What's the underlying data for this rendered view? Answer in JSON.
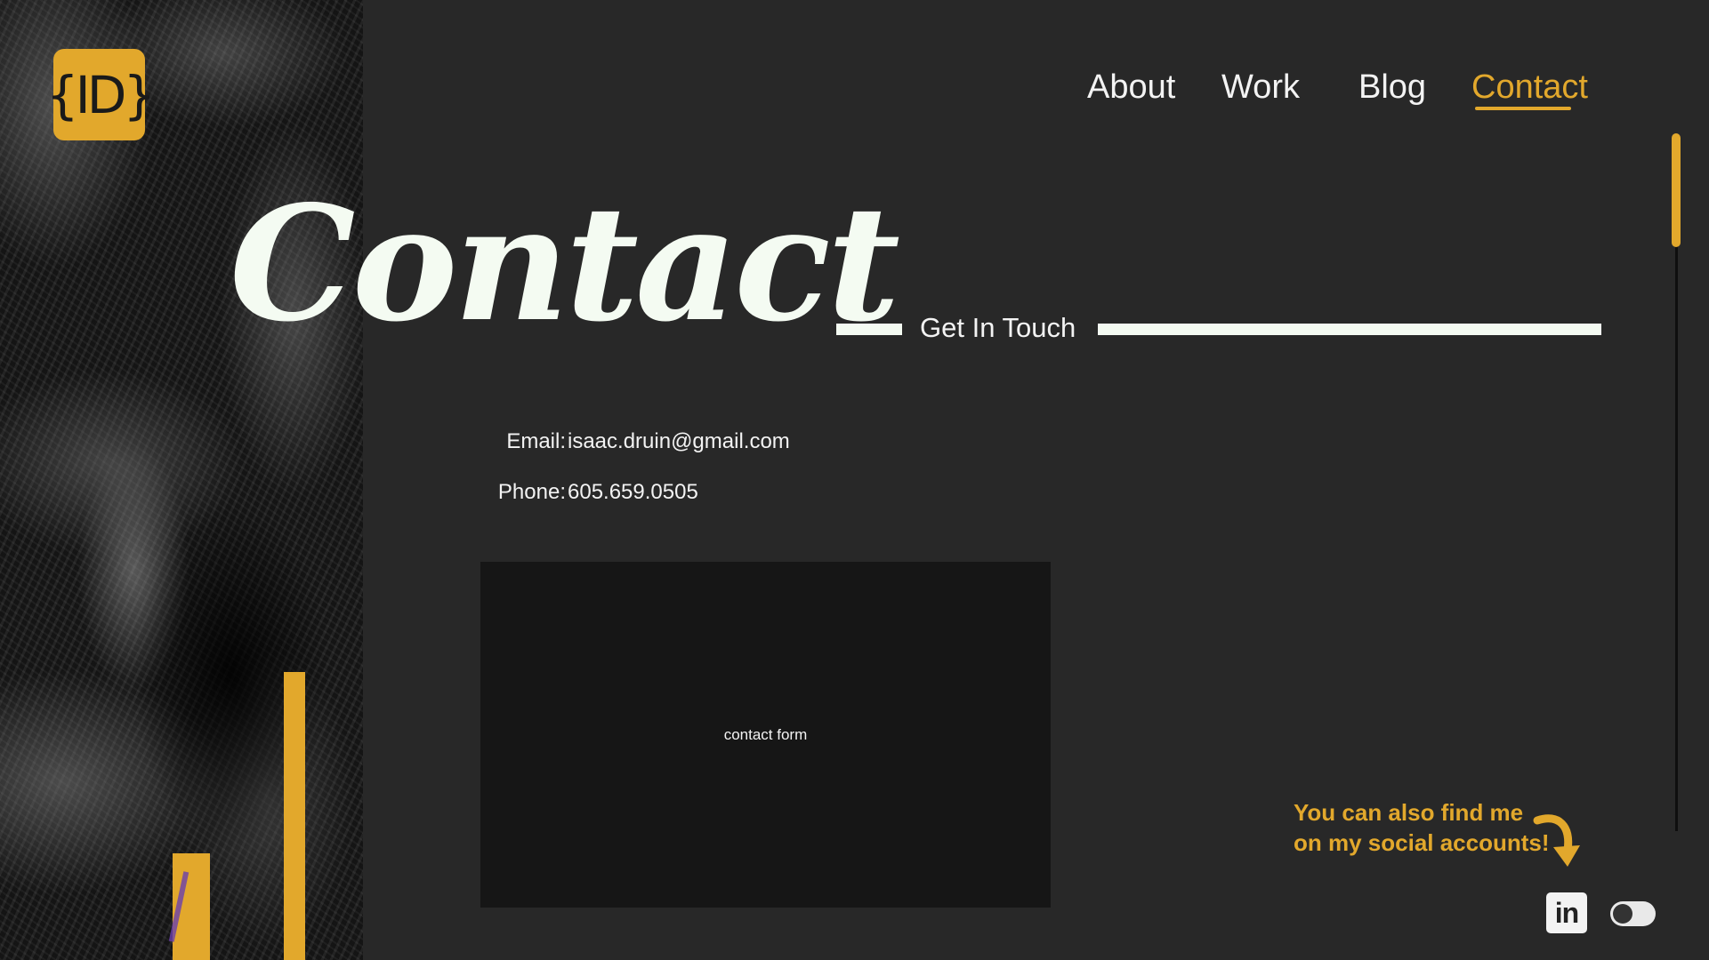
{
  "logo": {
    "text": "{ID}"
  },
  "nav": {
    "items": [
      {
        "label": "About"
      },
      {
        "label": "Work"
      },
      {
        "label": "Blog"
      },
      {
        "label": "Contact",
        "active": true
      }
    ]
  },
  "hero": {
    "title": "Contact",
    "subtitle": "Get In Touch"
  },
  "contact": {
    "email_label": "Email:",
    "email_value": "isaac.druin@gmail.com",
    "phone_label": "Phone:",
    "phone_value": "605.659.0505"
  },
  "form": {
    "placeholder": "contact form"
  },
  "social": {
    "note_line1": "You can also find me",
    "note_line2": "on my social accounts!",
    "linkedin_text": "in"
  },
  "colors": {
    "background": "#282828",
    "accent": "#e2a82c",
    "text": "#f3f3f3",
    "title": "#f4fbf2",
    "form_bg": "#161616"
  },
  "icons": [
    "logo-icon",
    "linkedin-icon",
    "curved-arrow-icon",
    "theme-toggle-icon"
  ]
}
